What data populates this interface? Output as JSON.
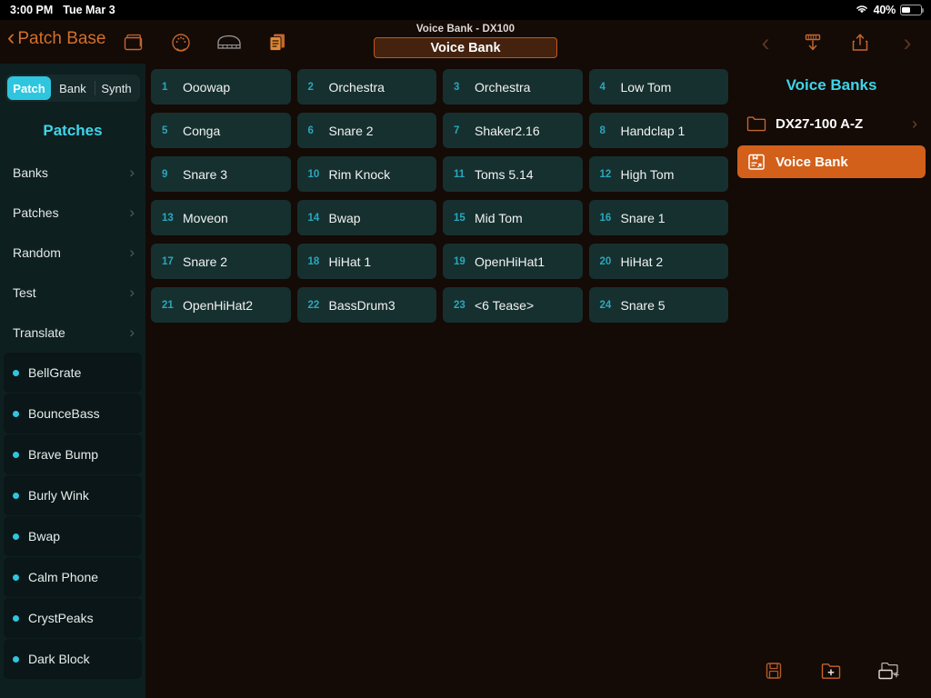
{
  "statusbar": {
    "time": "3:00 PM",
    "date": "Tue Mar 3",
    "battery_pct": "40%",
    "wifi_icon": "wifi-icon",
    "battery_icon": "battery-icon"
  },
  "toolbar": {
    "back_label": "Patch Base",
    "back_chevron": "‹",
    "icons": [
      {
        "name": "window-folder-icon"
      },
      {
        "name": "midi-din-icon"
      },
      {
        "name": "piano-keyboard-icon"
      },
      {
        "name": "document-copy-icon"
      }
    ],
    "subtitle": "Voice Bank - DX100",
    "title": "Voice Bank",
    "prev_chevron": "‹",
    "next_chevron": "›",
    "download_icon": "download-icon",
    "share_icon": "share-export-icon"
  },
  "sidebar": {
    "segments": [
      {
        "label": "Patch",
        "active": true
      },
      {
        "label": "Bank",
        "active": false
      },
      {
        "label": "Synth",
        "active": false
      }
    ],
    "title": "Patches",
    "nav": [
      {
        "label": "Banks",
        "chevron": "›"
      },
      {
        "label": "Patches",
        "chevron": "›"
      },
      {
        "label": "Random",
        "chevron": "›"
      },
      {
        "label": "Test",
        "chevron": "›"
      },
      {
        "label": "Translate",
        "chevron": "›"
      }
    ],
    "patches": [
      {
        "label": "BellGrate"
      },
      {
        "label": "BounceBass"
      },
      {
        "label": "Brave Bump"
      },
      {
        "label": "Burly Wink"
      },
      {
        "label": "Bwap"
      },
      {
        "label": "Calm Phone"
      },
      {
        "label": "CrystPeaks"
      },
      {
        "label": "Dark Block"
      }
    ]
  },
  "main": {
    "cells": [
      {
        "num": "1",
        "name": "Ooowap"
      },
      {
        "num": "2",
        "name": "Orchestra"
      },
      {
        "num": "3",
        "name": "Orchestra"
      },
      {
        "num": "4",
        "name": "Low Tom"
      },
      {
        "num": "5",
        "name": "Conga"
      },
      {
        "num": "6",
        "name": "Snare 2"
      },
      {
        "num": "7",
        "name": "Shaker2.16"
      },
      {
        "num": "8",
        "name": "Handclap 1"
      },
      {
        "num": "9",
        "name": "Snare 3"
      },
      {
        "num": "10",
        "name": "Rim Knock"
      },
      {
        "num": "11",
        "name": "Toms 5.14"
      },
      {
        "num": "12",
        "name": "High Tom"
      },
      {
        "num": "13",
        "name": "Moveon"
      },
      {
        "num": "14",
        "name": "Bwap"
      },
      {
        "num": "15",
        "name": "Mid Tom"
      },
      {
        "num": "16",
        "name": "Snare 1"
      },
      {
        "num": "17",
        "name": "Snare 2"
      },
      {
        "num": "18",
        "name": "HiHat 1"
      },
      {
        "num": "19",
        "name": "OpenHiHat1"
      },
      {
        "num": "20",
        "name": "HiHat 2"
      },
      {
        "num": "21",
        "name": "OpenHiHat2"
      },
      {
        "num": "22",
        "name": "BassDrum3"
      },
      {
        "num": "23",
        "name": "<6 Tease>"
      },
      {
        "num": "24",
        "name": "Snare 5"
      }
    ]
  },
  "rightpanel": {
    "title": "Voice Banks",
    "rows": [
      {
        "label": "DX27-100 A-Z",
        "icon": "folder-icon",
        "selected": false,
        "chevron": "›"
      },
      {
        "label": "Voice Bank",
        "icon": "bank-document-icon",
        "selected": true,
        "chevron": ""
      }
    ],
    "bottom_icons": [
      {
        "name": "save-floppy-icon"
      },
      {
        "name": "new-folder-icon"
      },
      {
        "name": "duplicate-folder-icon"
      }
    ]
  },
  "colors": {
    "accent_orange": "#d2601a",
    "accent_cyan": "#3fd4e8",
    "cell_bg": "#16302f",
    "sidebar_bg": "#0e1f20",
    "page_bg": "#140a06"
  }
}
